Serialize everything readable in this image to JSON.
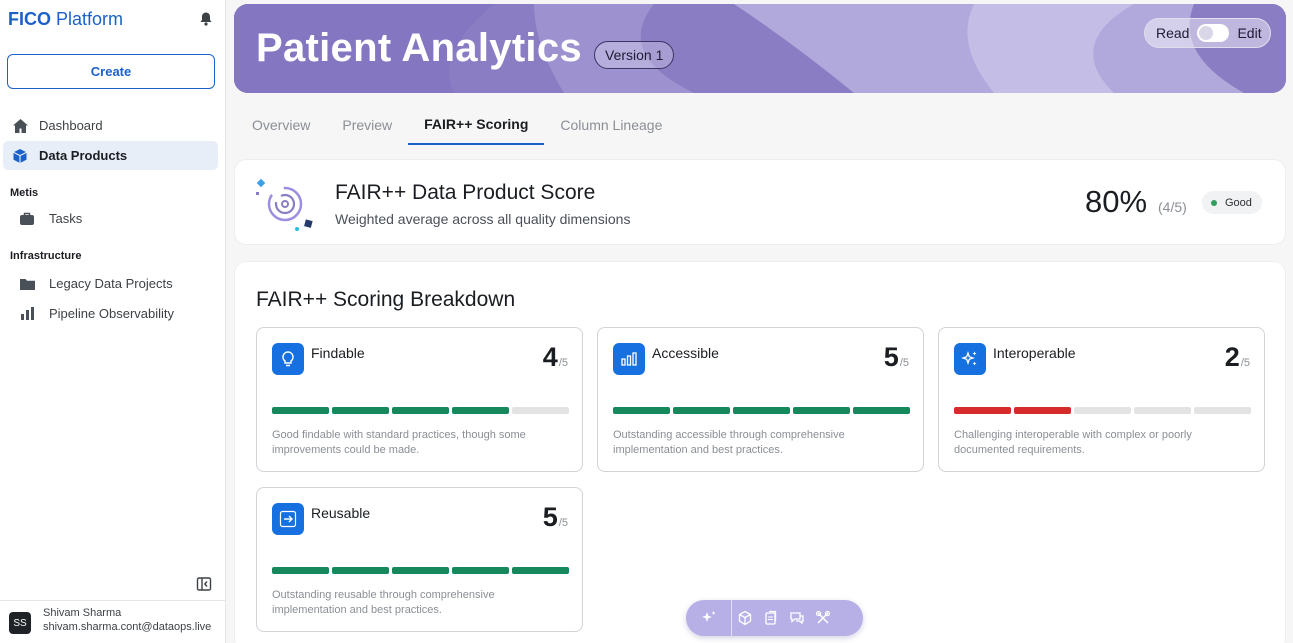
{
  "brand": {
    "name_bold": "FICO",
    "name_rest": " Platform"
  },
  "sidebar": {
    "create_label": "Create",
    "items": [
      {
        "label": "Dashboard",
        "icon": "home-icon"
      },
      {
        "label": "Data Products",
        "icon": "cube-icon",
        "active": true
      }
    ],
    "sections": [
      {
        "label": "Metis",
        "items": [
          {
            "label": "Tasks",
            "icon": "briefcase-icon"
          }
        ]
      },
      {
        "label": "Infrastructure",
        "items": [
          {
            "label": "Legacy Data Projects",
            "icon": "folder-icon"
          },
          {
            "label": "Pipeline Observability",
            "icon": "bar-chart-icon"
          }
        ]
      }
    ]
  },
  "user": {
    "initials": "SS",
    "name": "Shivam Sharma",
    "email": "shivam.sharma.cont@dataops.live"
  },
  "header": {
    "title": "Patient Analytics",
    "version": "Version 1",
    "toggle_left": "Read",
    "toggle_right": "Edit",
    "toggle_on": false
  },
  "tabs": [
    {
      "label": "Overview"
    },
    {
      "label": "Preview"
    },
    {
      "label": "FAIR++ Scoring",
      "active": true
    },
    {
      "label": "Column Lineage"
    }
  ],
  "score": {
    "title": "FAIR++ Data Product Score",
    "subtitle": "Weighted average across all quality dimensions",
    "percent": "80%",
    "fraction": "(4/5)",
    "badge": "Good"
  },
  "breakdown": {
    "title": "FAIR++ Scoring Breakdown",
    "dimensions": [
      {
        "name": "Findable",
        "score": "4",
        "out_of": "/5",
        "filled": 4,
        "level": "green",
        "icon": "lightbulb-icon",
        "description": "Good findable with standard practices, though some improvements could be made."
      },
      {
        "name": "Accessible",
        "score": "5",
        "out_of": "/5",
        "filled": 5,
        "level": "green",
        "icon": "bars-icon",
        "description": "Outstanding accessible through comprehensive implementation and best practices."
      },
      {
        "name": "Interoperable",
        "score": "2",
        "out_of": "/5",
        "filled": 2,
        "level": "red",
        "icon": "sparkles-icon",
        "description": "Challenging interoperable with complex or poorly documented requirements."
      },
      {
        "name": "Reusable",
        "score": "5",
        "out_of": "/5",
        "filled": 5,
        "level": "green",
        "icon": "arrow-right-icon",
        "description": "Outstanding reusable through comprehensive implementation and best practices."
      }
    ]
  },
  "colors": {
    "accent": "#1b61c9",
    "banner": "#8c7ec4",
    "good": "#16885c",
    "bad": "#d72b2b",
    "dim_icon": "#1670e0"
  }
}
